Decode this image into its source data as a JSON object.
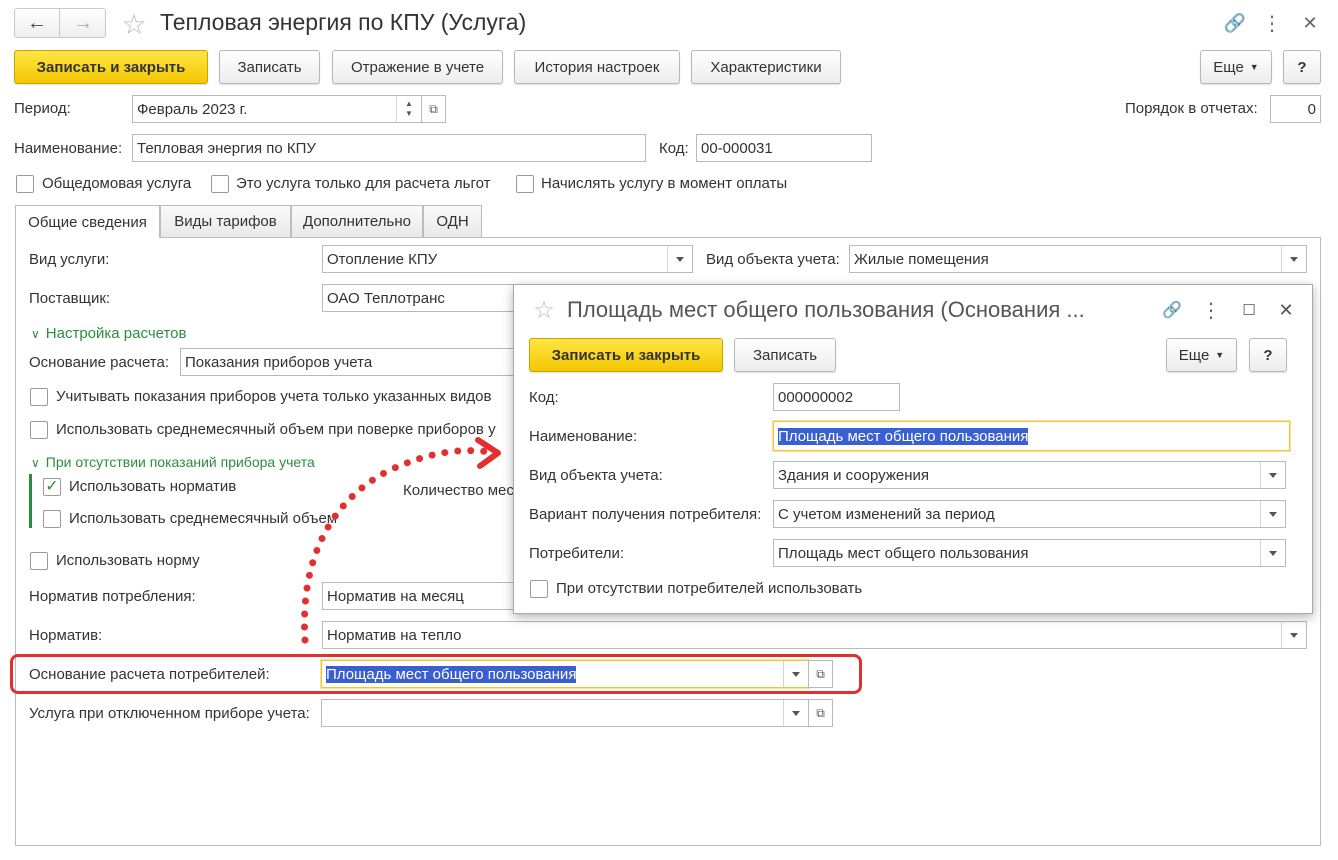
{
  "window": {
    "title": "Тепловая энергия по КПУ (Услуга)"
  },
  "toolbar": {
    "save_close": "Записать и закрыть",
    "save": "Записать",
    "accounting": "Отражение в учете",
    "history": "История настроек",
    "characteristics": "Характеристики",
    "more": "Еще",
    "help": "?"
  },
  "form": {
    "period_label": "Период:",
    "period_value": "Февраль 2023 г.",
    "order_label": "Порядок в отчетах:",
    "order_value": "0",
    "name_label": "Наименование:",
    "name_value": "Тепловая энергия по КПУ",
    "code_label": "Код:",
    "code_value": "00-000031",
    "cb_common": "Общедомовая услуга",
    "cb_benefits": "Это услуга только для расчета льгот",
    "cb_payment": "Начислять услугу в момент оплаты"
  },
  "tabs": [
    "Общие сведения",
    "Виды тарифов",
    "Дополнительно",
    "ОДН"
  ],
  "general": {
    "service_type_label": "Вид услуги:",
    "service_type_value": "Отопление КПУ",
    "object_type_label": "Вид объекта учета:",
    "object_type_value": "Жилые помещения",
    "supplier_label": "Поставщик:",
    "supplier_value": "ОАО Теплотранс",
    "calc_settings": "Настройка расчетов",
    "calc_basis_label": "Основание расчета:",
    "calc_basis_value": "Показания приборов учета",
    "cb_only_types": "Учитывать показания приборов учета только указанных видов",
    "cb_avg_volume": "Использовать среднемесячный объем при поверке приборов у",
    "no_readings": "При отсутствии показаний прибора учета",
    "cb_use_norm": "Использовать норматив",
    "cb_use_avg": "Использовать среднемесячный объем",
    "months_count": "Количество мес",
    "cb_norm": "Использовать норму",
    "consumption_norm_label": "Норматив потребления:",
    "consumption_norm_value": "Норматив на месяц",
    "norm_label": "Норматив:",
    "norm_value": "Норматив на тепло",
    "consumers_basis_label": "Основание расчета потребителей:",
    "consumers_basis_value": "Площадь мест общего пользования",
    "disabled_meter_label": "Услуга при отключенном приборе учета:",
    "disabled_meter_value": ""
  },
  "popup": {
    "title": "Площадь мест общего пользования (Основания ...",
    "save_close": "Записать и закрыть",
    "save": "Записать",
    "more": "Еще",
    "help": "?",
    "code_label": "Код:",
    "code_value": "000000002",
    "name_label": "Наименование:",
    "name_value": "Площадь мест общего пользования",
    "object_label": "Вид объекта учета:",
    "object_value": "Здания и сооружения",
    "variant_label": "Вариант получения потребителя:",
    "variant_value": "С учетом изменений за период",
    "consumers_label": "Потребители:",
    "consumers_value": "Площадь мест общего пользования",
    "cb_absent": "При отсутствии потребителей использовать"
  },
  "colors": {
    "accent_yellow": "#f3c800",
    "annotation_red": "#e03030",
    "green": "#2a8e3e",
    "selection": "#3a5fd0"
  }
}
